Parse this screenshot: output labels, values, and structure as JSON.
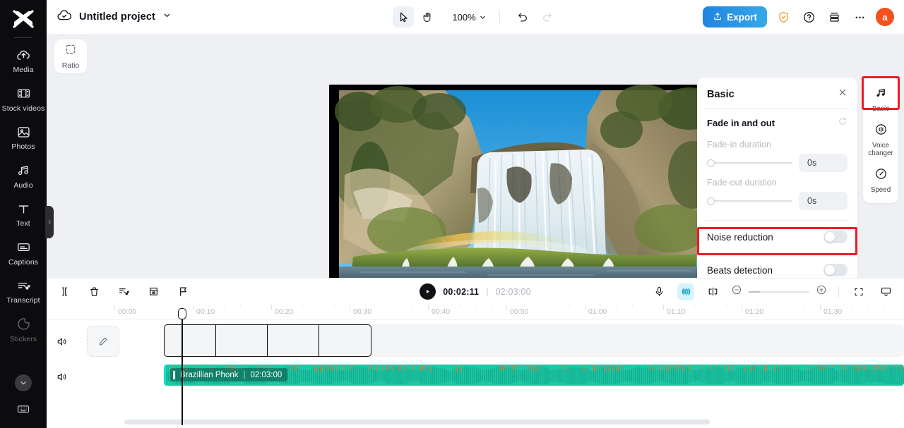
{
  "left_rail": {
    "logo": "logo-icon",
    "items": [
      {
        "label": "Media",
        "icon": "cloud-upload-icon"
      },
      {
        "label": "Stock videos",
        "icon": "film-strip-icon"
      },
      {
        "label": "Photos",
        "icon": "image-icon"
      },
      {
        "label": "Audio",
        "icon": "music-notes-icon"
      },
      {
        "label": "Text",
        "icon": "text-t-icon"
      },
      {
        "label": "Captions",
        "icon": "captions-icon"
      },
      {
        "label": "Transcript",
        "icon": "transcript-scissors-icon"
      },
      {
        "label": "Stickers",
        "icon": "sticker-icon"
      }
    ],
    "expand_icon": "chevron-down-icon",
    "bottom_icon": "keyboard-icon",
    "collapse_icon": "chevron-right-icon"
  },
  "topbar": {
    "cloud_icon": "cloud-check-icon",
    "project_name": "Untitled project",
    "project_chevron": "chevron-down-icon",
    "select_tool_icon": "cursor-arrow-icon",
    "hand_tool_icon": "hand-icon",
    "zoom_level": "100%",
    "zoom_chevron": "chevron-down-icon",
    "undo_icon": "undo-icon",
    "redo_icon": "redo-icon",
    "export_label": "Export",
    "export_icon": "export-upload-icon",
    "shield_icon": "shield-icon",
    "help_icon": "question-circle-icon",
    "layers_icon": "stack-icon",
    "more_icon": "ellipsis-icon",
    "avatar_initial": "a",
    "export_color": "#2a94e4",
    "avatar_color": "#f4511e"
  },
  "stage": {
    "ratio_label": "Ratio",
    "ratio_icon": "crop-frame-icon"
  },
  "properties": {
    "title": "Basic",
    "close_icon": "close-icon",
    "fade_section_label": "Fade in and out",
    "reset_icon": "reset-circular-icon",
    "fade_in_label": "Fade-in duration",
    "fade_in_value": "0s",
    "fade_out_label": "Fade-out duration",
    "fade_out_value": "0s",
    "noise_reduction_label": "Noise reduction",
    "noise_reduction_on": false,
    "beats_detection_label": "Beats detection",
    "beats_detection_on": false,
    "highlight_color": "#ee1c25"
  },
  "right_rail": {
    "items": [
      {
        "label": "Basic",
        "icon": "music-notes-icon",
        "active": true
      },
      {
        "label": "Voice changer",
        "icon": "voice-waveform-icon",
        "active": false
      },
      {
        "label": "Speed",
        "icon": "speedometer-icon",
        "active": false
      }
    ]
  },
  "timeline": {
    "tools_left": [
      {
        "name": "split-icon"
      },
      {
        "name": "delete-trash-icon"
      },
      {
        "name": "ai-cut-scissors-icon"
      },
      {
        "name": "ai-frame-icon"
      },
      {
        "name": "marker-flag-icon"
      }
    ],
    "play_icon": "play-icon",
    "current_time": "00:02:11",
    "time_separator": "|",
    "total_time": "02:03:00",
    "tools_right": [
      {
        "name": "microphone-icon"
      },
      {
        "name": "mixer-icon"
      },
      {
        "name": "transition-icon"
      },
      {
        "name": "zoom-out-icon"
      },
      {
        "name": "zoom-in-icon"
      },
      {
        "name": "fit-screen-icon"
      },
      {
        "name": "monitor-icon"
      }
    ],
    "ruler_labels": [
      "00:00",
      "00:10",
      "00:20",
      "00:30",
      "00:40",
      "00:50",
      "01:00",
      "01:10",
      "01:20",
      "01:30"
    ],
    "tracks": [
      {
        "type": "video",
        "speaker_icon": "speaker-icon",
        "edit_icon": "pencil-icon",
        "frames": 4
      },
      {
        "type": "audio",
        "speaker_icon": "speaker-icon",
        "clip_name": "Brazillian Phonk",
        "clip_duration": "02:03:00",
        "clip_color": "#1ec8a5"
      }
    ],
    "playhead_time": "00:02:11"
  }
}
